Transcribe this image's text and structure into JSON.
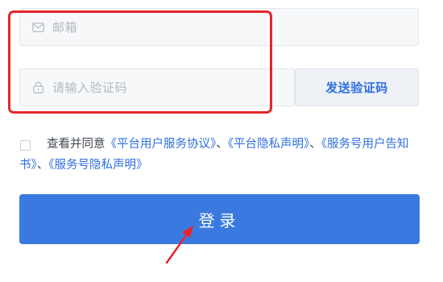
{
  "form": {
    "email_placeholder": "邮箱",
    "code_placeholder": "请输入验证码",
    "send_code_label": "发送验证码"
  },
  "agreement": {
    "prefix": "查看并同意",
    "platform_service": "《平台用户服务协议》",
    "sep1": "、",
    "platform_privacy": "《平台隐私声明》",
    "sep2": "、",
    "account_notice": "《服务号用户告知书》",
    "sep3": "、",
    "account_privacy": "《服务号隐私声明》"
  },
  "login_label": "登录",
  "colors": {
    "accent": "#3a7ae0",
    "link": "#2f6fe0",
    "highlight": "#e8242b"
  }
}
